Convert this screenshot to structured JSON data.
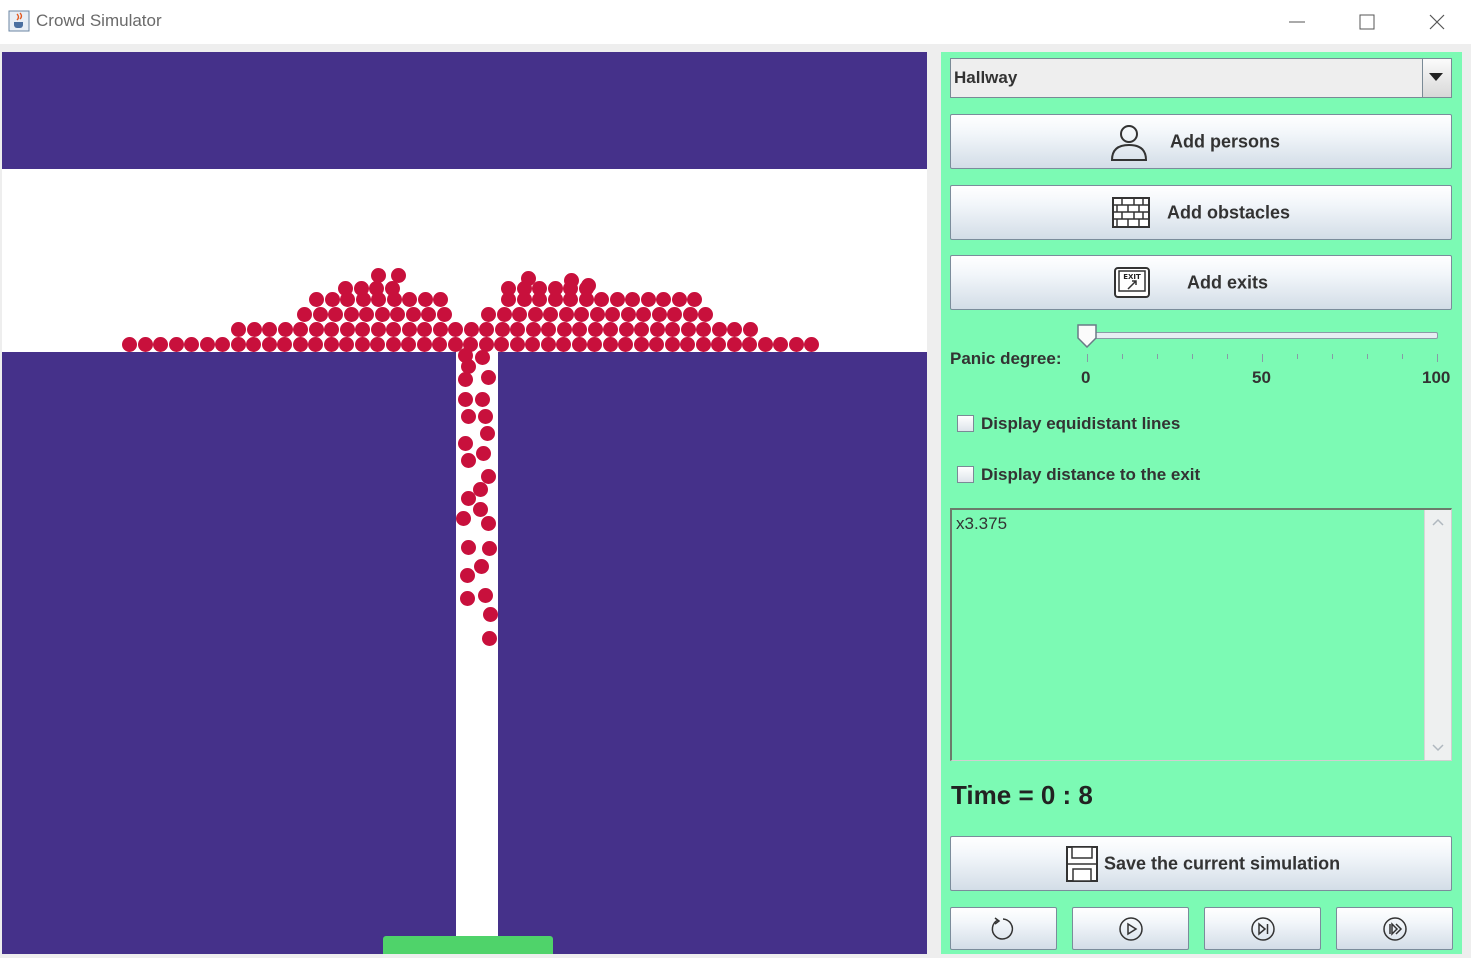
{
  "window": {
    "title": "Crowd Simulator",
    "controls": [
      "minimize",
      "maximize",
      "close"
    ]
  },
  "icons": {
    "app": "java-cup-icon",
    "minimize": "minimize-icon",
    "maximize": "maximize-icon",
    "close": "close-icon",
    "persons": "person-icon",
    "obstacles": "brick-wall-icon",
    "exits": "exit-sign-icon",
    "save": "floppy-disk-icon",
    "reset": "reset-icon",
    "play": "play-icon",
    "step": "step-forward-icon",
    "fast": "fast-forward-icon"
  },
  "colors": {
    "canvas_background": "#45318a",
    "walkable_area": "#ffffff",
    "person": "#c8103c",
    "exit": "#4fd36a",
    "panel_background": "#7cfab4"
  },
  "panel": {
    "scenario_select": {
      "value": "Hallway"
    },
    "buttons": {
      "add_persons": "Add persons",
      "add_obstacles": "Add obstacles",
      "add_exits": "Add exits",
      "save": "Save the current simulation"
    },
    "panic": {
      "label": "Panic degree:",
      "value": 0,
      "min": 0,
      "max": 100,
      "tick_labels": [
        "0",
        "50",
        "100"
      ]
    },
    "checkboxes": [
      {
        "label": "Display equidistant lines",
        "checked": false
      },
      {
        "label": "Display distance to the exit",
        "checked": false
      }
    ],
    "log_text": "x3.375",
    "time": "Time = 0 : 8",
    "playback_buttons": [
      "reset",
      "play",
      "step",
      "fast-forward"
    ]
  }
}
